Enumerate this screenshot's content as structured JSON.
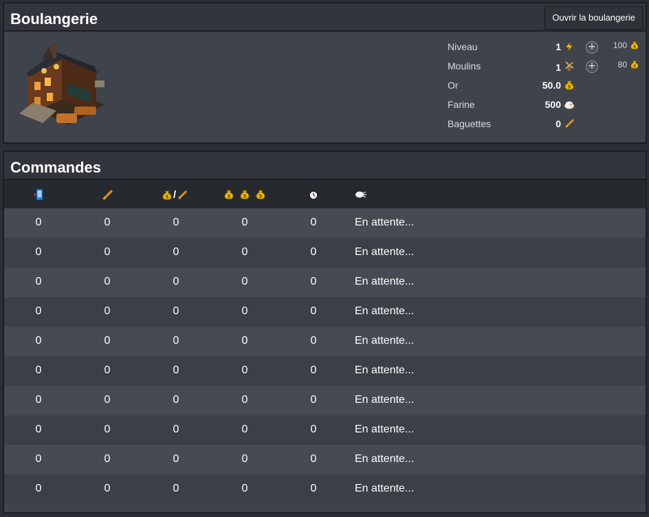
{
  "bakery": {
    "title": "Boulangerie",
    "open_button": "Ouvrir la boulangerie",
    "stats": [
      {
        "label": "Niveau",
        "value": "1",
        "icon": "lightning-icon",
        "upgrade_cost": "100"
      },
      {
        "label": "Moulins",
        "value": "1",
        "icon": "windmill-icon",
        "upgrade_cost": "80"
      },
      {
        "label": "Or",
        "value": "50.0",
        "icon": "gold-bag-icon"
      },
      {
        "label": "Farine",
        "value": "500",
        "icon": "flour-icon"
      },
      {
        "label": "Baguettes",
        "value": "0",
        "icon": "baguette-icon"
      }
    ]
  },
  "orders": {
    "title": "Commandes",
    "columns": [
      {
        "icon": "phone-icon"
      },
      {
        "icon": "baguette-icon"
      },
      {
        "icon": "gold-per-baguette-icon",
        "separator": "/"
      },
      {
        "icon": "three-gold-bags-icon"
      },
      {
        "icon": "clock-icon"
      },
      {
        "icon": "speech-bubble-icon"
      }
    ],
    "rows": [
      [
        "0",
        "0",
        "0",
        "0",
        "0",
        "En attente..."
      ],
      [
        "0",
        "0",
        "0",
        "0",
        "0",
        "En attente..."
      ],
      [
        "0",
        "0",
        "0",
        "0",
        "0",
        "En attente..."
      ],
      [
        "0",
        "0",
        "0",
        "0",
        "0",
        "En attente..."
      ],
      [
        "0",
        "0",
        "0",
        "0",
        "0",
        "En attente..."
      ],
      [
        "0",
        "0",
        "0",
        "0",
        "0",
        "En attente..."
      ],
      [
        "0",
        "0",
        "0",
        "0",
        "0",
        "En attente..."
      ],
      [
        "0",
        "0",
        "0",
        "0",
        "0",
        "En attente..."
      ],
      [
        "0",
        "0",
        "0",
        "0",
        "0",
        "En attente..."
      ],
      [
        "0",
        "0",
        "0",
        "0",
        "0",
        "En attente..."
      ]
    ]
  },
  "colors": {
    "gold": "#e8b80c",
    "baguette": "#e9a83a",
    "panel": "#3f434b",
    "header": "#32353c"
  }
}
